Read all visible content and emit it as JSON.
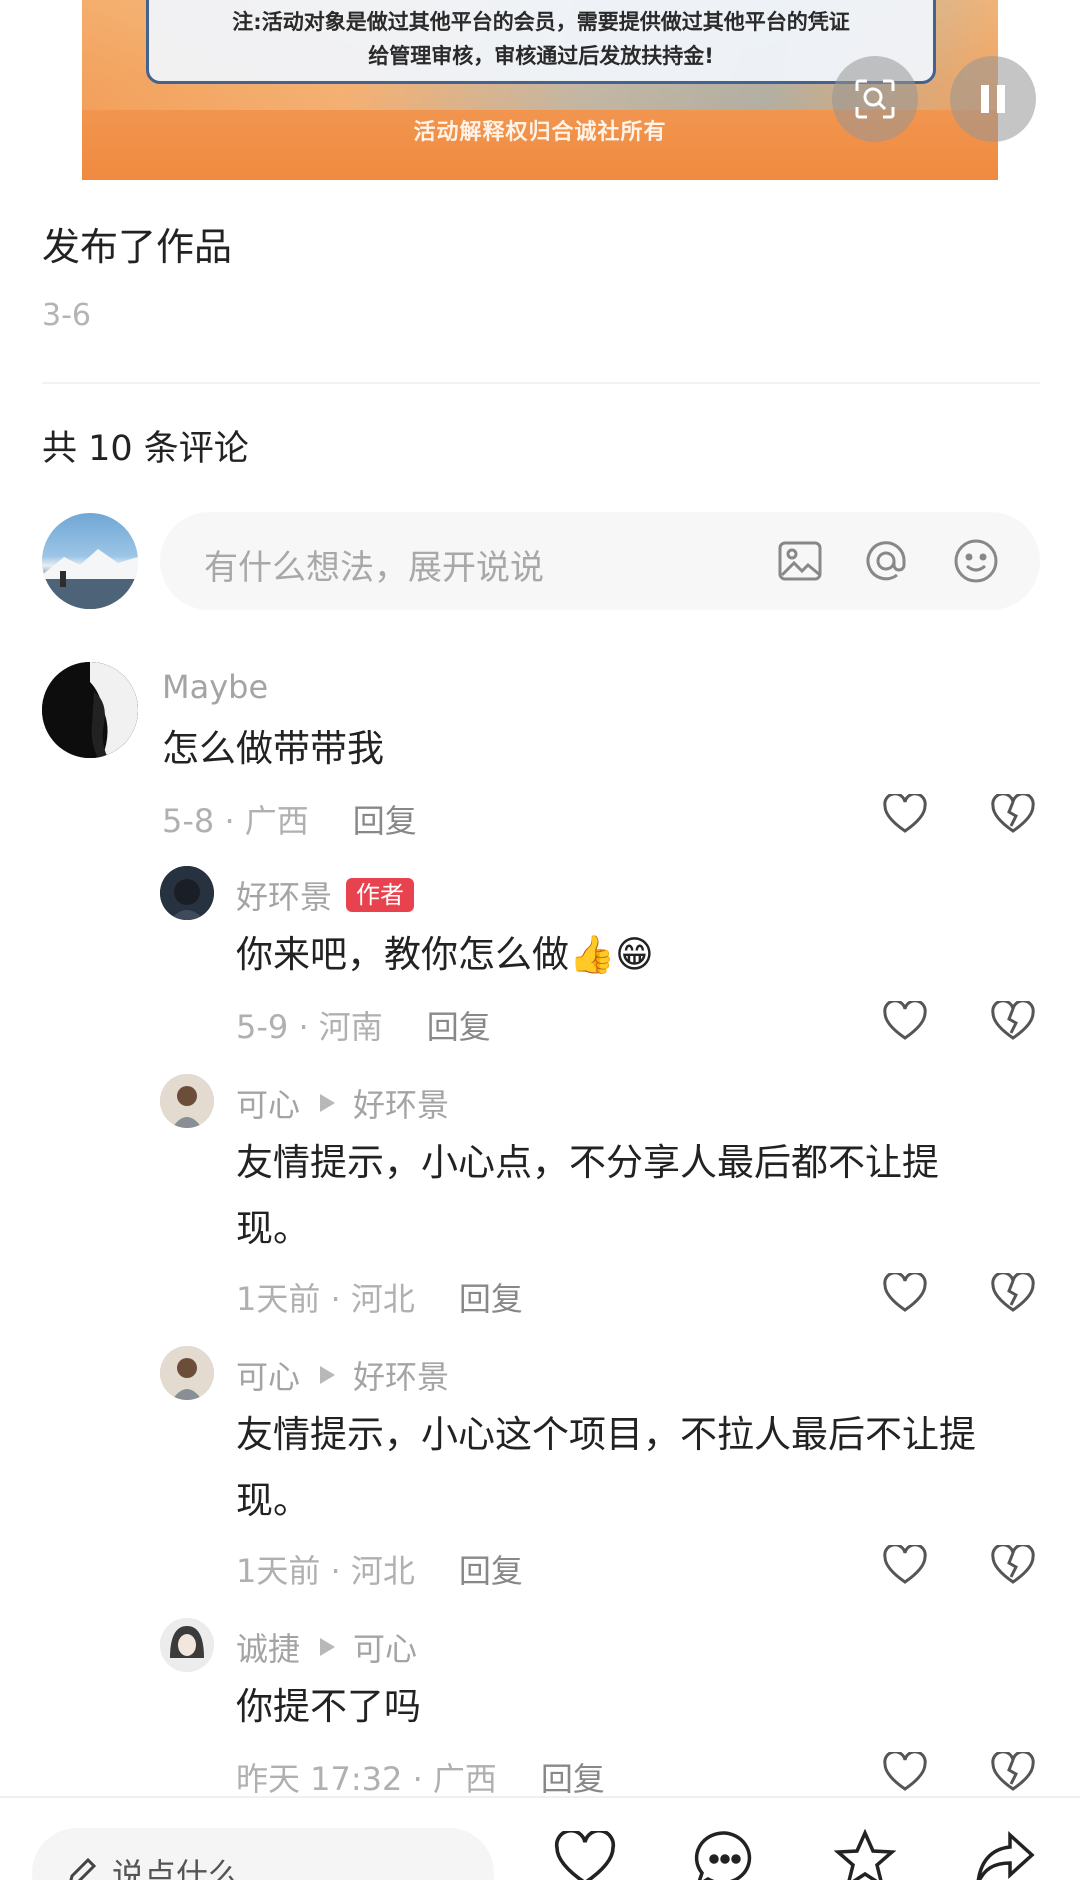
{
  "banner": {
    "notice_line1": "注:活动对象是做过其他平台的会员，需要提供做过其他平台的凭证",
    "notice_line2": "给管理审核，审核通过后发放扶持金!",
    "footer": "活动解释权归合诚社所有",
    "buttons": [
      "scan-icon",
      "pause-icon"
    ]
  },
  "post": {
    "title": "发布了作品",
    "date": "3-6"
  },
  "comments_header": "共 10 条评论",
  "input": {
    "placeholder": "有什么想法，展开说说",
    "icons": [
      "image-icon",
      "at-icon",
      "emoji-icon"
    ]
  },
  "comments": [
    {
      "name": "Maybe",
      "text": "怎么做带带我",
      "meta": "5-8 · 广西",
      "reply": "回复"
    },
    {
      "name": "好环景",
      "badge": "作者",
      "text": "你来吧，教你怎么做",
      "emojis": "👍😁",
      "meta": "5-9 · 河南",
      "reply": "回复"
    },
    {
      "name": "可心",
      "reply_to": "好环景",
      "text_line1": "友情提示，小心点，不分享人最后都不让提",
      "text_line2": "现。",
      "meta": "1天前 · 河北",
      "reply": "回复"
    },
    {
      "name": "可心",
      "reply_to": "好环景",
      "text_line1": "友情提示，小心这个项目，不拉人最后不让提",
      "text_line2": "现。",
      "meta": "1天前 · 河北",
      "reply": "回复"
    },
    {
      "name": "诚捷",
      "reply_to": "可心",
      "text": "你提不了吗",
      "meta": "昨天 17:32 · 广西",
      "reply": "回复"
    }
  ],
  "bottom_bar": {
    "say_placeholder": "说点什么...",
    "icons": [
      "heart-icon",
      "comment-icon",
      "star-icon",
      "share-icon"
    ]
  }
}
